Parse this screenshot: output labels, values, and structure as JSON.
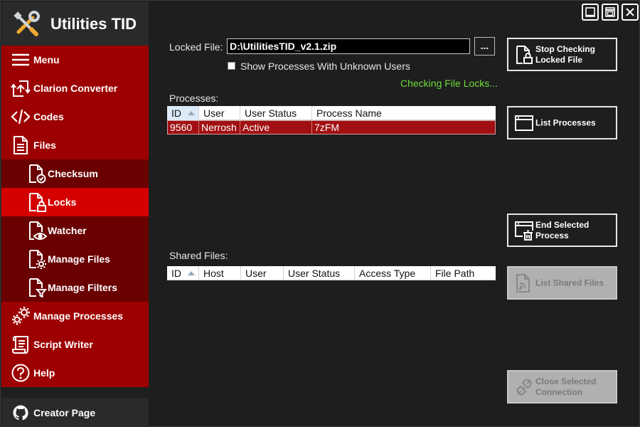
{
  "app": {
    "title": "Utilities TID"
  },
  "sidebar": {
    "items": [
      {
        "label": "Menu",
        "icon": "hamburger-icon"
      },
      {
        "label": "Clarion Converter",
        "icon": "convert-icon"
      },
      {
        "label": "Codes",
        "icon": "code-icon"
      },
      {
        "label": "Files",
        "icon": "file-icon"
      },
      {
        "label": "Checksum",
        "icon": "file-check-icon"
      },
      {
        "label": "Locks",
        "icon": "file-lock-icon"
      },
      {
        "label": "Watcher",
        "icon": "file-eye-icon"
      },
      {
        "label": "Manage Files",
        "icon": "file-gear-icon"
      },
      {
        "label": "Manage Filters",
        "icon": "file-filter-icon"
      },
      {
        "label": "Manage Processes",
        "icon": "gears-icon"
      },
      {
        "label": "Script Writer",
        "icon": "script-icon"
      },
      {
        "label": "Help",
        "icon": "help-icon"
      }
    ],
    "active": "Locks",
    "creator_label": "Creator Page"
  },
  "main": {
    "locked_file_label": "Locked File:",
    "locked_file_value": "D:\\UtilitiesTID_v2.1.zip",
    "browse_label": "...",
    "show_unknown_label": "Show Processes With Unknown Users",
    "show_unknown_checked": false,
    "status_text": "Checking File Locks...",
    "processes_label": "Processes:",
    "processes_columns": [
      "ID",
      "User",
      "User Status",
      "Process Name"
    ],
    "processes_rows": [
      {
        "id": "9560",
        "user": "Nerrosh",
        "user_status": "Active",
        "process_name": "7zFM"
      }
    ],
    "shared_files_label": "Shared Files:",
    "shared_columns": [
      "ID",
      "Host",
      "User",
      "User Status",
      "Access Type",
      "File Path"
    ]
  },
  "actions": {
    "stop_checking": "Stop Checking\nLocked File",
    "list_processes": "List Processes",
    "end_process": "End Selected\nProcess",
    "list_shared": "List Shared Files",
    "close_connection": "Close Selected\nConnection"
  },
  "colors": {
    "sidebar_top": "#9d0000",
    "sidebar_sub": "#6a0000",
    "sidebar_active": "#d40000",
    "selected_row": "#a10f12",
    "status_green": "#6fdc3a",
    "background": "#1e1e1e"
  }
}
